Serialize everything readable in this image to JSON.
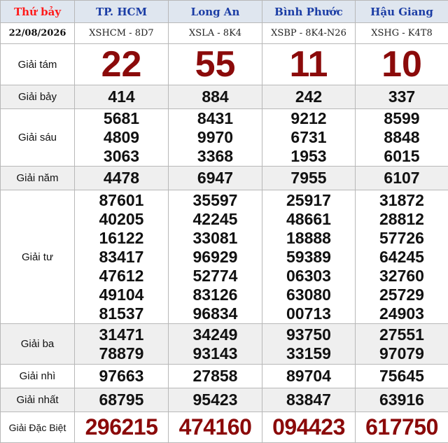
{
  "header": {
    "day": "Thứ bảy",
    "date": "22/08/2026",
    "provinces": [
      {
        "name": "TP. HCM",
        "code": "XSHCM - 8D7"
      },
      {
        "name": "Long An",
        "code": "XSLA - 8K4"
      },
      {
        "name": "Bình Phước",
        "code": "XSBP - 8K4-N26"
      },
      {
        "name": "Hậu Giang",
        "code": "XSHG - K4T8"
      }
    ]
  },
  "prizes": {
    "g8": {
      "label": "Giải tám",
      "values": [
        "22",
        "55",
        "11",
        "10"
      ]
    },
    "g7": {
      "label": "Giải bảy",
      "values": [
        "414",
        "884",
        "242",
        "337"
      ]
    },
    "g6": {
      "label": "Giải sáu",
      "values": [
        [
          "5681",
          "4809",
          "3063"
        ],
        [
          "8431",
          "9970",
          "3368"
        ],
        [
          "9212",
          "6731",
          "1953"
        ],
        [
          "8599",
          "8848",
          "6015"
        ]
      ]
    },
    "g5": {
      "label": "Giải năm",
      "values": [
        "4478",
        "6947",
        "7955",
        "6107"
      ]
    },
    "g4": {
      "label": "Giải tư",
      "values": [
        [
          "87601",
          "40205",
          "16122",
          "83417",
          "47612",
          "49104",
          "81537"
        ],
        [
          "35597",
          "42245",
          "33081",
          "96929",
          "52774",
          "83126",
          "96834"
        ],
        [
          "25917",
          "48661",
          "18888",
          "59389",
          "06303",
          "63080",
          "00713"
        ],
        [
          "31872",
          "28812",
          "57726",
          "64245",
          "32760",
          "25729",
          "24903"
        ]
      ]
    },
    "g3": {
      "label": "Giải ba",
      "values": [
        [
          "31471",
          "78879"
        ],
        [
          "34249",
          "93143"
        ],
        [
          "93750",
          "33159"
        ],
        [
          "27551",
          "97079"
        ]
      ]
    },
    "g2": {
      "label": "Giải nhì",
      "values": [
        "97663",
        "27858",
        "89704",
        "75645"
      ]
    },
    "g1": {
      "label": "Giải nhất",
      "values": [
        "68795",
        "95423",
        "83847",
        "63916"
      ]
    },
    "db": {
      "label": "Giải Đặc Biệt",
      "values": [
        "296215",
        "474160",
        "094423",
        "617750"
      ]
    }
  },
  "colors": {
    "header_bg": "#dfe6ef",
    "day_text": "#ff1a1a",
    "province_text": "#1b3da5",
    "highlight_number": "#8b0a0a",
    "alt_row_bg": "#efefef"
  }
}
